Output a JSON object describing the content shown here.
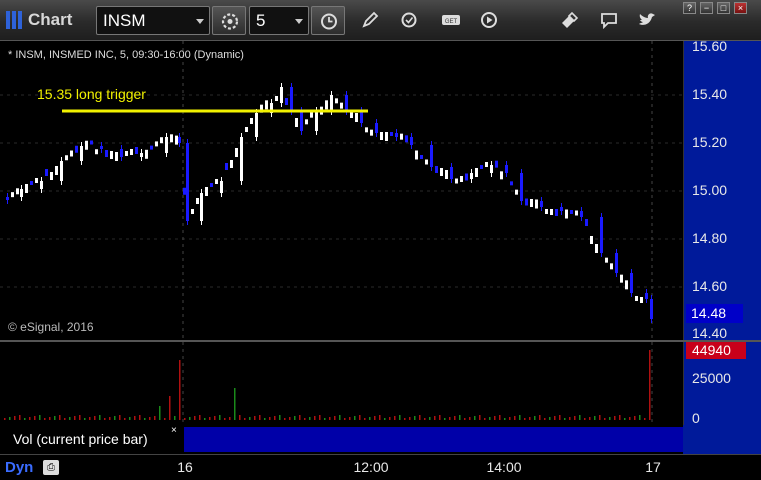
{
  "app": {
    "title": "Chart"
  },
  "toolbar": {
    "symbol": "INSM",
    "interval": "5",
    "tools": [
      "settings-gear-icon",
      "clock-icon",
      "pencil-icon",
      "refresh-icon",
      "get-data-icon",
      "play-icon",
      "eraser-icon",
      "comment-icon",
      "bird-icon"
    ],
    "window_buttons": [
      "?",
      "−",
      "□",
      "×"
    ]
  },
  "chart": {
    "header": "* INSM, INSMED INC, 5, 09:30-16:00 (Dynamic)",
    "annotation": "15.35 long trigger",
    "copyright": "© eSignal, 2016",
    "price_ticks": [
      "15.60",
      "15.40",
      "15.20",
      "15.00",
      "14.80",
      "14.60",
      "14.40"
    ],
    "last_price": "14.48",
    "colors": {
      "up": "#ffffff",
      "down": "#1a1aff",
      "trigger_line": "#f2f200",
      "axis_bg": "#001a9a"
    }
  },
  "volume": {
    "legend": "Vol (current price bar)",
    "close": "×",
    "last_value": "44940",
    "ticks": [
      "25000",
      "0"
    ]
  },
  "timebar": {
    "mode": "Dyn",
    "labels": [
      "16",
      "12:00",
      "14:00",
      "17"
    ]
  }
}
